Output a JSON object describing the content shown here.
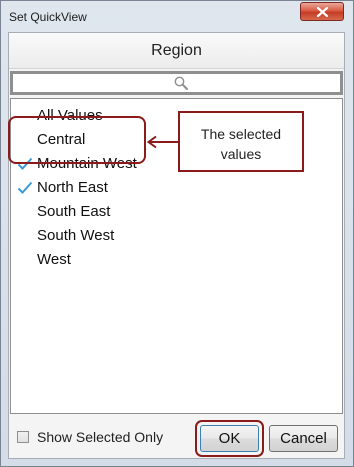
{
  "window": {
    "title": "Set QuickView"
  },
  "header": {
    "label": "Region"
  },
  "search": {
    "value": "",
    "placeholder": ""
  },
  "list": {
    "items": [
      {
        "label": "All Values",
        "selected": false
      },
      {
        "label": "Central",
        "selected": false
      },
      {
        "label": "Mountain West",
        "selected": true
      },
      {
        "label": "North East",
        "selected": true
      },
      {
        "label": "South East",
        "selected": false
      },
      {
        "label": "South West",
        "selected": false
      },
      {
        "label": "West",
        "selected": false
      }
    ]
  },
  "callout": {
    "text": "The selected values"
  },
  "footer": {
    "show_selected_label": "Show Selected Only",
    "show_selected_checked": false,
    "ok_label": "OK",
    "cancel_label": "Cancel"
  },
  "colors": {
    "accent_check": "#3a9ad9",
    "annotation": "#8b1a1a",
    "close_button": "#c9452b"
  },
  "icons": [
    "close-icon",
    "search-icon",
    "checkmark-icon",
    "arrow-left-icon"
  ]
}
